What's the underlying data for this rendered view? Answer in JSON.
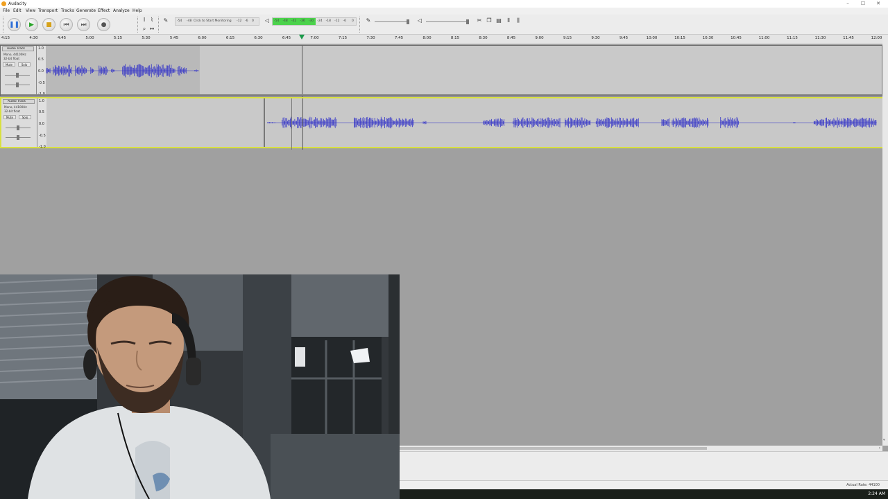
{
  "window": {
    "title": "Audacity",
    "app_icon": "audacity-icon",
    "controls": [
      "–",
      "☐",
      "✕"
    ]
  },
  "menu": [
    "File",
    "Edit",
    "View",
    "Transport",
    "Tracks",
    "Generate",
    "Effect",
    "Analyze",
    "Help"
  ],
  "transport": [
    {
      "name": "pause-button",
      "icon": "pause-icon",
      "glyph": "❚❚",
      "color": "#2f6fd6"
    },
    {
      "name": "play-button",
      "icon": "play-icon",
      "glyph": "▶",
      "color": "#2aa52a"
    },
    {
      "name": "stop-button",
      "icon": "stop-icon",
      "glyph": "■",
      "color": "#d6a21a"
    },
    {
      "name": "skip-start-button",
      "icon": "skip-start-icon",
      "glyph": "⏮",
      "color": "#555555"
    },
    {
      "name": "skip-end-button",
      "icon": "skip-end-icon",
      "glyph": "⏭",
      "color": "#555555"
    },
    {
      "name": "record-button",
      "icon": "record-icon",
      "glyph": "●",
      "color": "#555555"
    }
  ],
  "meters": {
    "record_hint": "Click to Start Monitoring",
    "record_scale": [
      "-54",
      "-48",
      "-12",
      "-6",
      "0"
    ],
    "playback_scale": [
      "-54",
      "-48",
      "-42",
      "-36",
      "-30",
      "-24",
      "-18",
      "-12",
      "-6",
      "0"
    ],
    "playback_level": 0.52
  },
  "ruler": {
    "labels": [
      "4:15",
      "4:30",
      "4:45",
      "5:00",
      "5:15",
      "5:30",
      "5:45",
      "6:00",
      "6:15",
      "6:30",
      "6:45",
      "7:00",
      "7:15",
      "7:30",
      "7:45",
      "8:00",
      "8:15",
      "8:30",
      "8:45",
      "9:00",
      "9:15",
      "9:30",
      "9:45",
      "10:00",
      "10:15",
      "10:30",
      "10:45",
      "11:00",
      "11:15",
      "11:30",
      "11:45",
      "12:00"
    ]
  },
  "tracks": [
    {
      "name": "Audio Track",
      "info_lines": [
        "Mono, 44100Hz",
        "32-bit float"
      ],
      "mute": "Mute",
      "solo": "Solo",
      "scale": [
        "1.0",
        "0.5",
        "0.0",
        "-0.5",
        "-1.0"
      ],
      "selected": false
    },
    {
      "name": "Audio Track",
      "info_lines": [
        "Mono, 44100Hz",
        "32-bit float"
      ],
      "mute": "Mute",
      "solo": "Solo",
      "scale": [
        "1.0",
        "0.5",
        "0.0",
        "-0.5",
        "-1.0"
      ],
      "selected": true
    }
  ],
  "status": {
    "actual_rate": "Actual Rate: 44100"
  },
  "taskbar": {
    "clock": "2:24 AM"
  },
  "colors": {
    "waveform": "#3232c8",
    "selection_border": "#d8e040",
    "meter_green": "#4cd24c"
  }
}
